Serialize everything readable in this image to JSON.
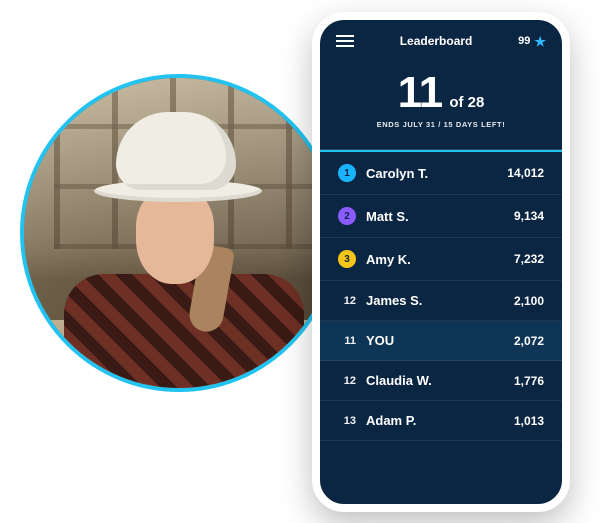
{
  "photo_alt": "Construction worker smiling with hard hat",
  "phone": {
    "header": {
      "title": "Leaderboard",
      "stars": "99"
    },
    "hero": {
      "rank": "11",
      "of_label": "of",
      "total": "28",
      "deadline": "ENDS JULY 31 /  15 DAYS LEFT!"
    },
    "rows": [
      {
        "rank": "1",
        "name": "Carolyn T.",
        "score": "14,012",
        "medal_color": "#19b4ff",
        "is_medal": true,
        "is_you": false
      },
      {
        "rank": "2",
        "name": "Matt S.",
        "score": "9,134",
        "medal_color": "#8a5cff",
        "is_medal": true,
        "is_you": false
      },
      {
        "rank": "3",
        "name": "Amy K.",
        "score": "7,232",
        "medal_color": "#f5c518",
        "is_medal": true,
        "is_you": false
      },
      {
        "rank": "12",
        "name": "James S.",
        "score": "2,100",
        "is_medal": false,
        "is_you": false
      },
      {
        "rank": "11",
        "name": "YOU",
        "score": "2,072",
        "is_medal": false,
        "is_you": true
      },
      {
        "rank": "12",
        "name": "Claudia W.",
        "score": "1,776",
        "is_medal": false,
        "is_you": false
      },
      {
        "rank": "13",
        "name": "Adam P.",
        "score": "1,013",
        "is_medal": false,
        "is_you": false
      }
    ]
  }
}
